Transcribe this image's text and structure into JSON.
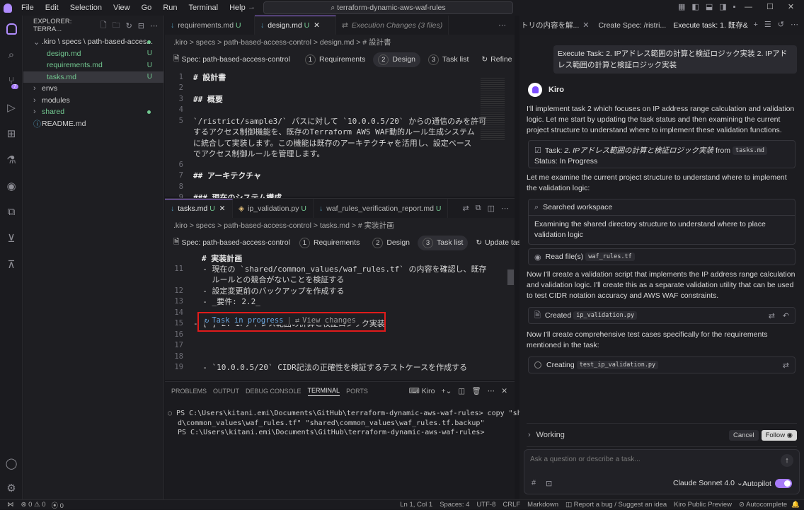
{
  "menu": [
    "File",
    "Edit",
    "Selection",
    "View",
    "Go",
    "Run",
    "Terminal",
    "Help"
  ],
  "search_text": "terraform-dynamic-aws-waf-rules",
  "explorer": {
    "title": "EXPLORER: TERRA...",
    "items": [
      {
        "label": ".kiro \\ specs \\ path-based-acces...",
        "status": "",
        "dot": true
      },
      {
        "label": "design.md",
        "status": "U"
      },
      {
        "label": "requirements.md",
        "status": "U"
      },
      {
        "label": "tasks.md",
        "status": "U"
      },
      {
        "label": "envs",
        "status": ""
      },
      {
        "label": "modules",
        "status": ""
      },
      {
        "label": "shared",
        "status": "",
        "dot": true
      },
      {
        "label": "README.md",
        "status": ""
      }
    ]
  },
  "top_tabs": [
    {
      "label": "requirements.md",
      "badge": "U"
    },
    {
      "label": "design.md",
      "badge": "U"
    },
    {
      "label": "Execution Changes (3 files)",
      "badge": ""
    }
  ],
  "top_breadcrumb": ".kiro > specs > path-based-access-control > design.md > # 設計書",
  "spec_title": "Spec: path-based-access-control",
  "steps_top": {
    "s1": "Requirements",
    "s2": "Design",
    "s3": "Task list",
    "action": "Refine"
  },
  "design_lines": [
    {
      "n": "1",
      "t": "# 設計書",
      "h": true
    },
    {
      "n": "2",
      "t": ""
    },
    {
      "n": "3",
      "t": "## 概要",
      "h": true
    },
    {
      "n": "4",
      "t": ""
    },
    {
      "n": "5",
      "t": "`/ristrict/sample3/` パスに対して `10.0.0.5/20` からの通信のみを許可"
    },
    {
      "n": "",
      "t": "するアクセス制御機能を、既存のTerraform AWS WAF動的ルール生成システム"
    },
    {
      "n": "",
      "t": "に統合して実装します。この機能は既存のアーキテクチャを活用し、設定ベース"
    },
    {
      "n": "",
      "t": "でアクセス制御ルールを管理します。"
    },
    {
      "n": "6",
      "t": ""
    },
    {
      "n": "7",
      "t": "## アーキテクチャ",
      "h": true
    },
    {
      "n": "8",
      "t": ""
    },
    {
      "n": "9",
      "t": "### 現在のシステム構成",
      "h": true
    }
  ],
  "bottom_tabs": [
    {
      "label": "tasks.md",
      "badge": "U"
    },
    {
      "label": "ip_validation.py",
      "badge": "U"
    },
    {
      "label": "waf_rules_verification_report.md",
      "badge": "U"
    }
  ],
  "bottom_breadcrumb": ".kiro > specs > path-based-access-control > tasks.md > # 実装計画",
  "steps_bottom": {
    "s1": "Requirements",
    "s2": "Design",
    "s3": "Task list",
    "action": "Update tasks"
  },
  "tasks_header": "# 実装計画",
  "tasks_lines": [
    {
      "n": "11",
      "t": "  - 現在の `shared/common_values/waf_rules.tf` の内容を確認し、既存"
    },
    {
      "n": "",
      "t": "    ルールとの競合がないことを検証する"
    },
    {
      "n": "12",
      "t": "  - 設定変更前のバックアップを作成する"
    },
    {
      "n": "13",
      "t": "  - _要件: 2.2_"
    },
    {
      "n": "14",
      "t": ""
    },
    {
      "n": "15",
      "t": "- [ ] 2. IPアドレス範囲の計算と検証ロジック実装"
    },
    {
      "n": "16",
      "t": ""
    },
    {
      "n": "17",
      "t": ""
    },
    {
      "n": "18",
      "t": ""
    },
    {
      "n": "19",
      "t": "  - `10.0.0.5/20` CIDR記法の正確性を検証するテストケースを作成する"
    }
  ],
  "task_codelens": {
    "progress": "Task in progress",
    "view": "View changes"
  },
  "panel_tabs": [
    "PROBLEMS",
    "OUTPUT",
    "DEBUG CONSOLE",
    "TERMINAL",
    "PORTS"
  ],
  "terminal_name": "Kiro",
  "terminal_lines": [
    "PS C:\\Users\\kitani.emi\\Documents\\GitHub\\terraform-dynamic-aws-waf-rules> copy \"share",
    "d\\common_values\\waf_rules.tf\" \"shared\\common_values\\waf_rules.tf.backup\"",
    "PS C:\\Users\\kitani.emi\\Documents\\GitHub\\terraform-dynamic-aws-waf-rules>"
  ],
  "chat": {
    "tabs": [
      "トリの内容を解...",
      "Create Spec: /ristri...",
      "Execute task: 1. 既存&"
    ],
    "user_message": "Execute Task: 2. IPアドレス範囲の計算と検証ロジック実装 2. IPアドレス範囲の計算と検証ロジック実装",
    "agent_name": "Kiro",
    "msg1": "I'll implement task 2 which focuses on IP address range calculation and validation logic. Let me start by updating the task status and then examining the current project structure to understand where to implement these validation functions.",
    "task_card": {
      "prefix": "Task: ",
      "title": "2. IPアドレス範囲の計算と検証ロジック実装",
      "from": " from ",
      "file": "tasks.md",
      "status": "Status: In Progress"
    },
    "msg2": "Let me examine the current project structure to understand where to implement the validation logic:",
    "searched": "Searched workspace",
    "searched_detail": "Examining the shared directory structure to understand where to place validation logic",
    "read_files": "Read file(s)",
    "read_file_name": "waf_rules.tf",
    "msg3": "Now I'll create a validation script that implements the IP address range calculation and validation logic. I'll create this as a separate validation utility that can be used to test CIDR notation accuracy and AWS WAF constraints.",
    "created": "Created",
    "created_file": "ip_validation.py",
    "msg4": "Now I'll create comprehensive test cases specifically for the requirements mentioned in the task:",
    "creating": "Creating",
    "creating_file": "test_ip_validation.py",
    "working": "Working",
    "cancel": "Cancel",
    "follow": "Follow",
    "input_placeholder": "Ask a question or describe a task...",
    "model": "Claude Sonnet 4.0",
    "autopilot": "Autopilot"
  },
  "status": {
    "errors": "0",
    "warnings": "0",
    "ports": "0",
    "position": "Ln 1, Col 1",
    "spaces": "Spaces: 4",
    "encoding": "UTF-8",
    "eol": "CRLF",
    "language": "Markdown",
    "report": "Report a bug / Suggest an idea",
    "preview": "Kiro Public Preview",
    "autocomplete": "Autocomplete"
  },
  "colors": {
    "accent": "#a77bf8",
    "highlight_box": "#e01b1b",
    "git_untracked": "#73c991"
  }
}
